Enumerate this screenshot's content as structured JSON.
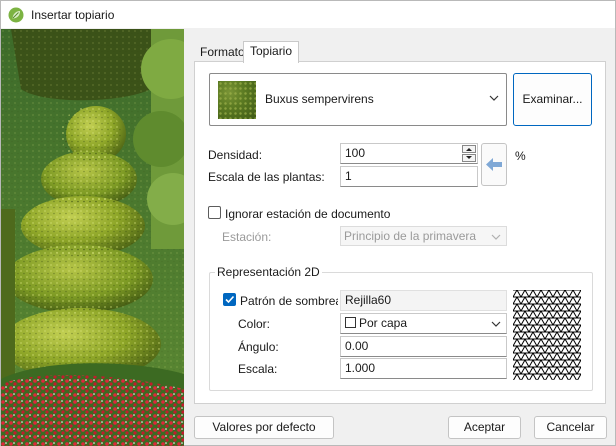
{
  "window": {
    "title": "Insertar topiario",
    "app_icon": "leaf-icon"
  },
  "tabs": [
    {
      "label": "Formato",
      "active": false
    },
    {
      "label": "Topiario",
      "active": true
    }
  ],
  "plant": {
    "selected": "Buxus sempervirens",
    "browse_label": "Examinar..."
  },
  "density": {
    "label": "Densidad:",
    "value": "100",
    "unit": "%"
  },
  "scale_plants": {
    "label": "Escala de las plantas:",
    "value": "1"
  },
  "ignore_station": {
    "label": "Ignorar estación de documento",
    "checked": false
  },
  "station": {
    "label": "Estación:",
    "value": "Principio de la primavera",
    "enabled": false
  },
  "rep2d": {
    "title": "Representación 2D",
    "hatch_label": "Patrón de sombread",
    "hatch_checked": true,
    "hatch_value": "Rejilla60",
    "color_label": "Color:",
    "color_value": "Por capa",
    "angle_label": "Ángulo:",
    "angle_value": "0.00",
    "scale_label": "Escala:",
    "scale_value": "1.000"
  },
  "footer": {
    "defaults_label": "Valores por defecto",
    "ok_label": "Aceptar",
    "cancel_label": "Cancelar"
  },
  "colors": {
    "accent": "#0067c0",
    "panel_bg": "#ffffff",
    "window_bg": "#f0f0f0"
  }
}
